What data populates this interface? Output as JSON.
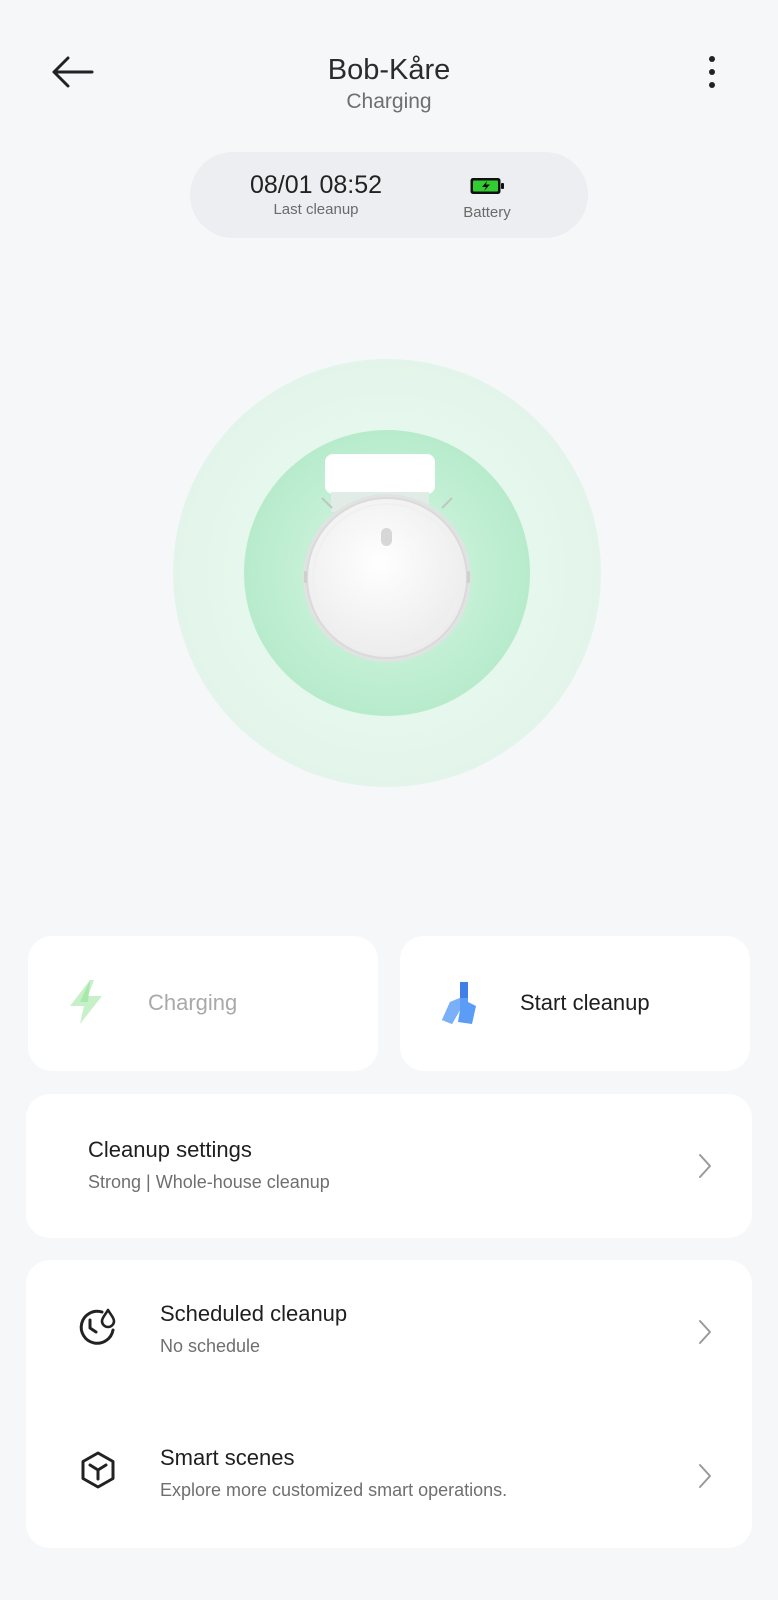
{
  "header": {
    "title": "Bob-Kåre",
    "status": "Charging"
  },
  "status_pill": {
    "last_cleanup_value": "08/01 08:52",
    "last_cleanup_label": "Last cleanup",
    "battery_label": "Battery"
  },
  "actions": {
    "charging_label": "Charging",
    "start_label": "Start cleanup"
  },
  "cleanup_settings": {
    "title": "Cleanup settings",
    "subtitle": "Strong | Whole-house cleanup"
  },
  "scheduled": {
    "title": "Scheduled cleanup",
    "subtitle": "No schedule"
  },
  "smart_scenes": {
    "title": "Smart scenes",
    "subtitle": "Explore more customized smart operations."
  },
  "colors": {
    "background": "#f6f7f9",
    "accent_green": "#5bd68a",
    "accent_blue": "#4d8cf5",
    "battery_green": "#33cc33"
  },
  "icons": {
    "back": "arrow-left-icon",
    "more": "more-vertical-icon",
    "battery": "battery-charging-icon",
    "charging": "lightning-icon",
    "start": "broom-icon",
    "scheduled": "clock-droplet-icon",
    "smart": "cube-icon",
    "chevron": "chevron-right-icon"
  }
}
